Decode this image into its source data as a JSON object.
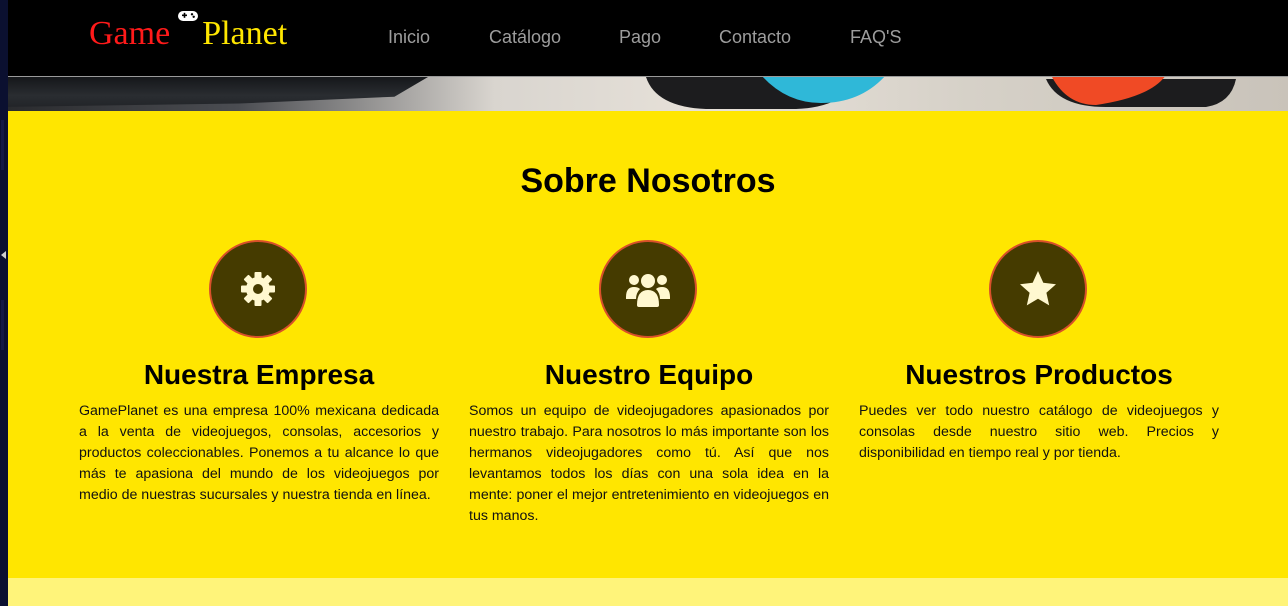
{
  "header": {
    "logo": {
      "part1": "Game",
      "part2": "Planet",
      "icon": "gamepad-icon",
      "colors": {
        "part1": "#ff1a1a",
        "part2": "#ffe600"
      }
    },
    "nav": [
      {
        "label": "Inicio"
      },
      {
        "label": "Catálogo"
      },
      {
        "label": "Pago"
      },
      {
        "label": "Contacto"
      },
      {
        "label": "FAQ'S"
      }
    ]
  },
  "banner": {
    "image": "controller-photo"
  },
  "about": {
    "title": "Sobre Nosotros",
    "columns": [
      {
        "icon": "gear-icon",
        "title": "Nuestra Empresa",
        "text": "GamePlanet es una empresa 100% mexicana dedicada a la venta de videojuegos, consolas, accesorios y productos coleccionables. Ponemos a tu alcance lo que más te apasiona del mundo de los videojuegos por medio de nuestras sucursales y nuestra tienda en línea."
      },
      {
        "icon": "users-icon",
        "title": "Nuestro Equipo",
        "text": "Somos un equipo de videojugadores apasionados por nuestro trabajo. Para nosotros lo más importante son los hermanos videojugadores como tú. Así que nos levantamos todos los días con una sola idea en la mente: poner el mejor entretenimiento en videojuegos en tus manos."
      },
      {
        "icon": "star-icon",
        "title": "Nuestros Productos",
        "text": "Puedes ver todo nuestro catálogo de videojuegos y consolas desde nuestro sitio web. Precios y disponibilidad en tiempo real y por tienda."
      }
    ]
  },
  "colors": {
    "accent": "#ffe600",
    "nav_background": "#000000",
    "icon_circle": "#453b00",
    "icon_border": "#d8502a",
    "footer_band": "#fff47a"
  }
}
